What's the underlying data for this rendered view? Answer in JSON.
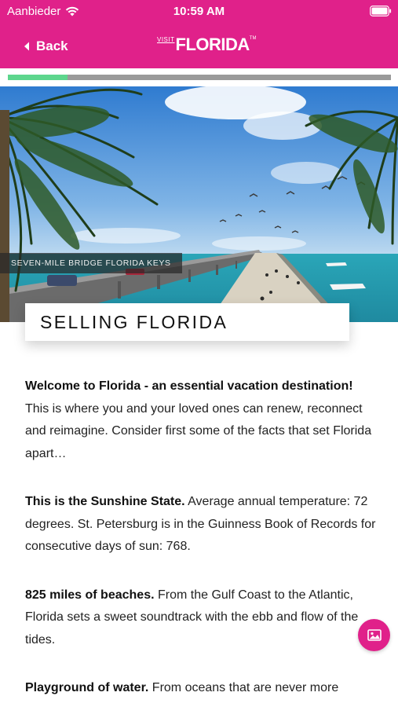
{
  "status_bar": {
    "carrier": "Aanbieder",
    "time": "10:59 AM",
    "icons": [
      "wifi-icon",
      "battery-icon"
    ]
  },
  "nav": {
    "back_label": "Back",
    "back_icon": "chevron-left-icon",
    "brand_visit": "VISIT",
    "brand_name": "FLORIDA",
    "brand_tm": "TM"
  },
  "progress": {
    "fraction": 0.155
  },
  "hero": {
    "caption": "SEVEN-MILE BRIDGE FLORIDA KEYS"
  },
  "article": {
    "title": "SELLING FLORIDA",
    "paragraphs": [
      {
        "lead": "Welcome to Florida - an essential vacation destination!",
        "text": " This is where you and your loved ones can renew, reconnect and reimagine. Consider first some of the facts that set Florida apart…"
      },
      {
        "lead": "This is the Sunshine State.",
        "text": " Average annual temperature: 72 degrees. St. Petersburg is in the Guinness Book of Records for consecutive days of sun: 768."
      },
      {
        "lead": "825 miles of beaches.",
        "text": " From the Gulf Coast to the Atlantic, Florida sets a sweet soundtrack with the ebb and flow of the tides."
      },
      {
        "lead": "Playground of water.",
        "text": " From oceans that are never more"
      }
    ]
  },
  "gallery_button": {
    "icon": "image-icon"
  },
  "colors": {
    "brand_pink": "#e0218a",
    "progress_fill": "#5dd68d",
    "progress_track": "#9a9a9a"
  }
}
